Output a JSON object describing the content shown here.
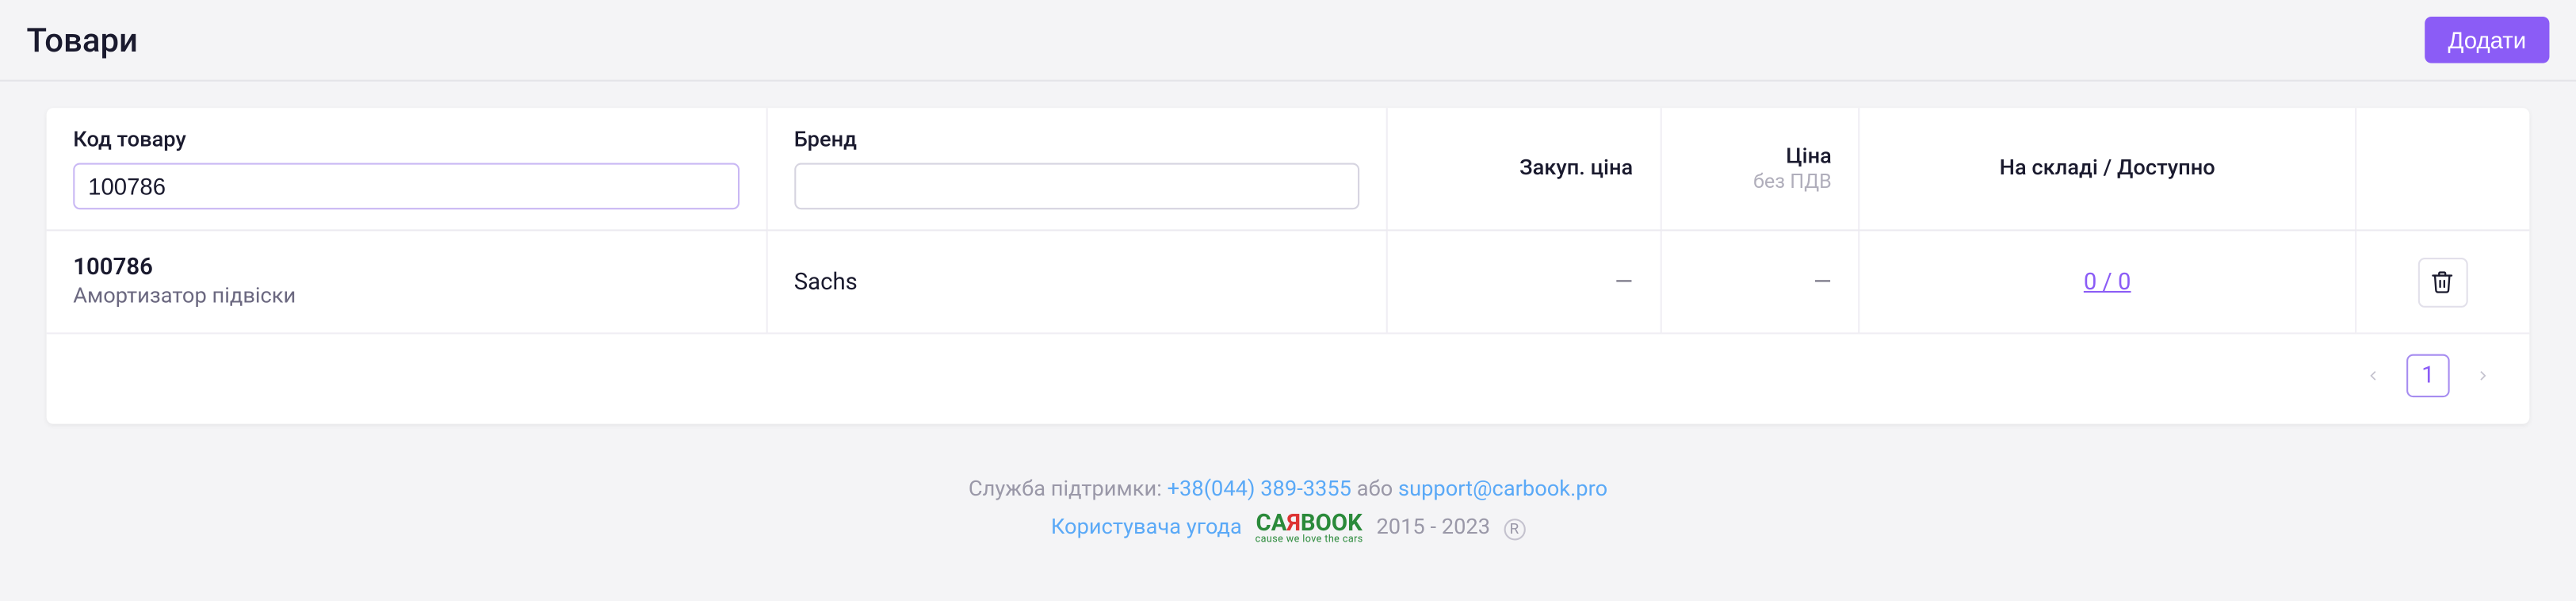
{
  "header": {
    "title": "Товари",
    "add_label": "Додати"
  },
  "columns": {
    "code": "Код товару",
    "brand": "Бренд",
    "buy_price": "Закуп. ціна",
    "price": "Ціна",
    "price_sub": "без ПДВ",
    "stock": "На складі / Доступно"
  },
  "filters": {
    "code": "100786",
    "brand": ""
  },
  "rows": [
    {
      "code": "100786",
      "name": "Амортизатор підвіски",
      "brand": "Sachs",
      "buy_price": "—",
      "price": "—",
      "stock": "0 / 0"
    }
  ],
  "pagination": {
    "current": "1"
  },
  "footer": {
    "support_prefix": "Служба підтримки: ",
    "phone": "+38(044) 389-3355",
    "or": " або ",
    "email": "support@carbook.pro",
    "agreement": "Користувача угода",
    "logo_ca": "CA",
    "logo_r": "Я",
    "logo_book": "BOOK",
    "logo_sub": "cause we love the cars",
    "years": "2015 - 2023",
    "reg": "R"
  }
}
